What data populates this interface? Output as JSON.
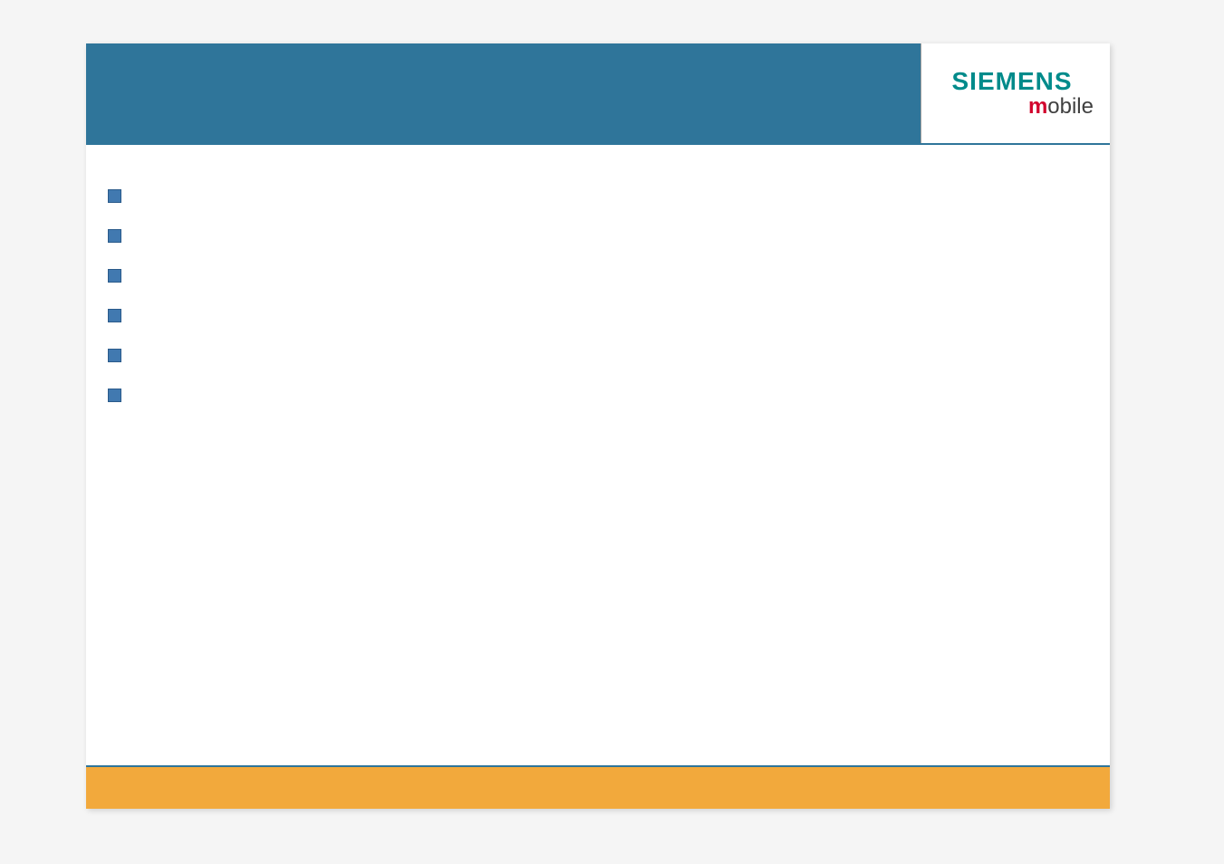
{
  "logo": {
    "top": "SIEMENS",
    "bottom_prefix": "m",
    "bottom_rest": "obile"
  },
  "bullets": [
    {
      "text": ""
    },
    {
      "text": ""
    },
    {
      "text": ""
    },
    {
      "text": ""
    },
    {
      "text": ""
    },
    {
      "text": ""
    }
  ],
  "colors": {
    "teal_header": "#2F759A",
    "orange_footer": "#F2A93C",
    "bullet_blue": "#4179B0",
    "siemens_teal": "#008B8B",
    "m_red": "#D2042D"
  }
}
